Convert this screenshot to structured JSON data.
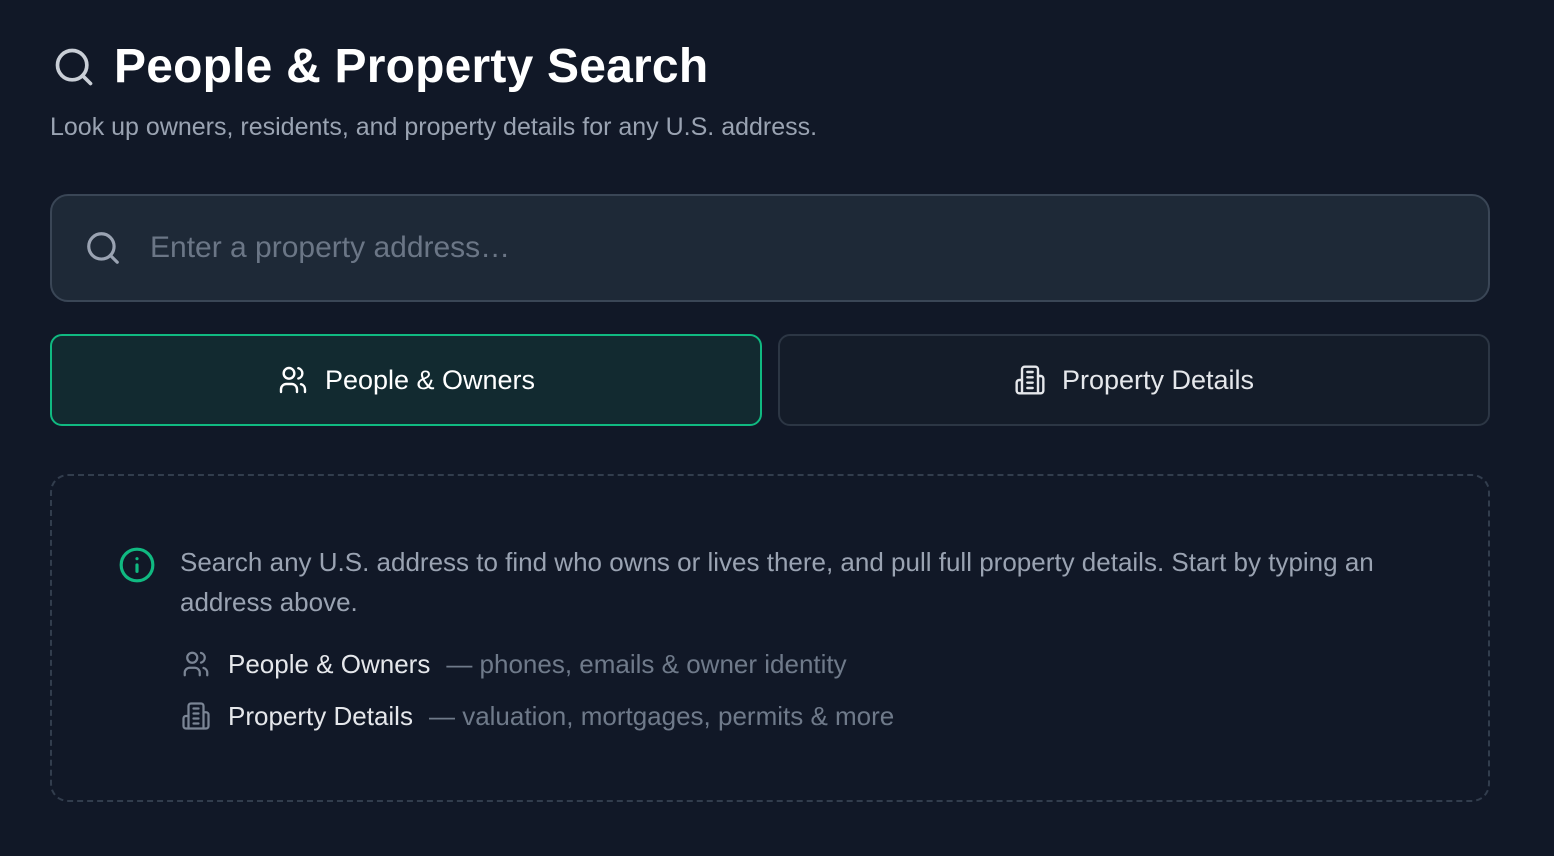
{
  "header": {
    "title": "People & Property Search",
    "subtitle": "Look up owners, residents, and property details for any U.S. address.",
    "icon": "search-icon"
  },
  "search": {
    "placeholder": "Enter a property address…",
    "value": "",
    "icon": "search-icon"
  },
  "tabs": [
    {
      "label": "People & Owners",
      "icon": "people-icon",
      "active": true
    },
    {
      "label": "Property Details",
      "icon": "building-icon",
      "active": false
    }
  ],
  "info": {
    "icon": "info-icon",
    "text": "Search any U.S. address to find who owns or lives there, and pull full property details. Start by typing an address above.",
    "features": [
      {
        "name": "People & Owners",
        "desc": "— phones, emails & owner identity",
        "icon": "people-icon"
      },
      {
        "name": "Property Details",
        "desc": "— valuation, mortgages, permits & more",
        "icon": "building-icon"
      }
    ]
  },
  "colors": {
    "background": "#111827",
    "accent": "#10b981",
    "active_tab_bg": "#122a30"
  }
}
